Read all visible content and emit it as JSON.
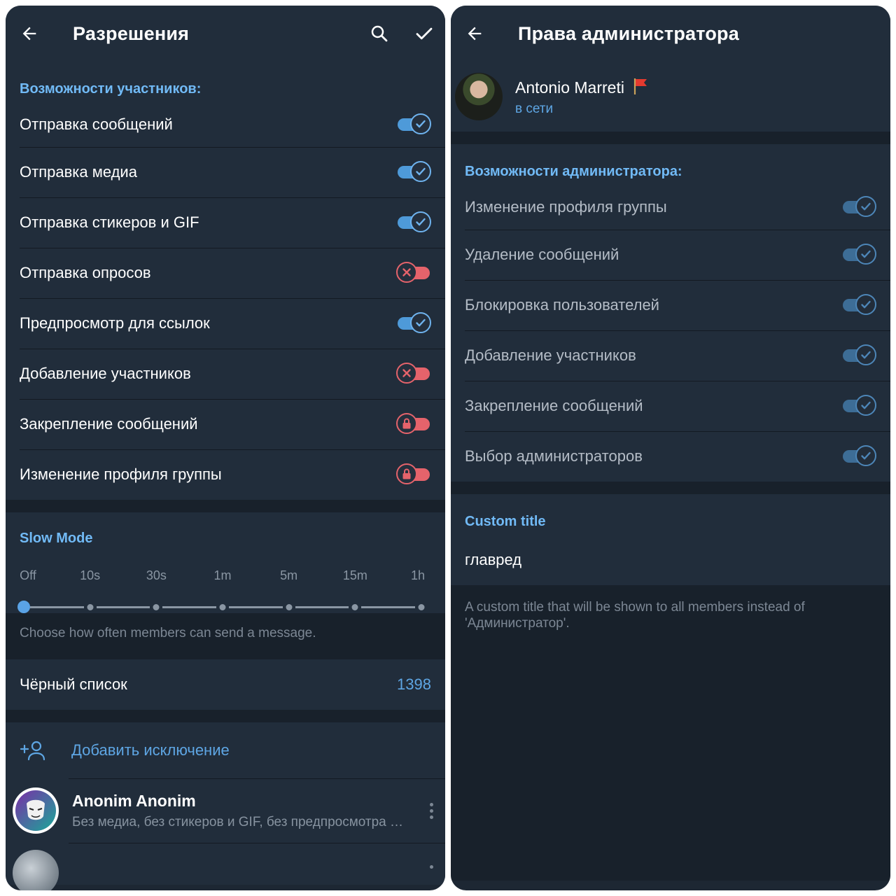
{
  "left": {
    "title": "Разрешения",
    "back_icon": "arrow-left-icon",
    "search_icon": "search-icon",
    "confirm_icon": "checkmark-icon",
    "members_header": "Возможности участников:",
    "permissions": [
      {
        "label": "Отправка сообщений",
        "state": "on"
      },
      {
        "label": "Отправка медиа",
        "state": "on"
      },
      {
        "label": "Отправка стикеров и GIF",
        "state": "on"
      },
      {
        "label": "Отправка опросов",
        "state": "off"
      },
      {
        "label": "Предпросмотр для ссылок",
        "state": "on"
      },
      {
        "label": "Добавление участников",
        "state": "off"
      },
      {
        "label": "Закрепление сообщений",
        "state": "locked"
      },
      {
        "label": "Изменение профиля группы",
        "state": "locked"
      }
    ],
    "slow_mode": {
      "title": "Slow Mode",
      "options": [
        "Off",
        "10s",
        "30s",
        "1m",
        "5m",
        "15m",
        "1h"
      ],
      "selected_index": 0,
      "hint": "Choose how often members can send a message."
    },
    "blacklist": {
      "label": "Чёрный список",
      "count": "1398"
    },
    "add_exception": "Добавить исключение",
    "exceptions": [
      {
        "name": "Anonim Anonim",
        "subtitle": "Без медиа, без стикеров и GIF, без предпросмотра ссылок"
      }
    ]
  },
  "right": {
    "title": "Права администратора",
    "back_icon": "arrow-left-icon",
    "user": {
      "name": "Antonio Marreti",
      "status": "в сети",
      "flag_icon": "red-flag-icon"
    },
    "admin_header": "Возможности администратора:",
    "rights": [
      {
        "label": "Изменение профиля группы",
        "state": "on"
      },
      {
        "label": "Удаление сообщений",
        "state": "on"
      },
      {
        "label": "Блокировка пользователей",
        "state": "on"
      },
      {
        "label": "Добавление участников",
        "state": "on"
      },
      {
        "label": "Закрепление сообщений",
        "state": "on"
      },
      {
        "label": "Выбор администраторов",
        "state": "on"
      }
    ],
    "custom_title": {
      "header": "Custom title",
      "value": "главред",
      "hint": "A custom title that will be shown to all members instead of 'Администратор'."
    }
  },
  "colors": {
    "background": "#1d2733",
    "section": "#212d3b",
    "accent": "#5ea6e4",
    "toggle_on": "#4e9ad9",
    "toggle_off": "#e5636b"
  }
}
